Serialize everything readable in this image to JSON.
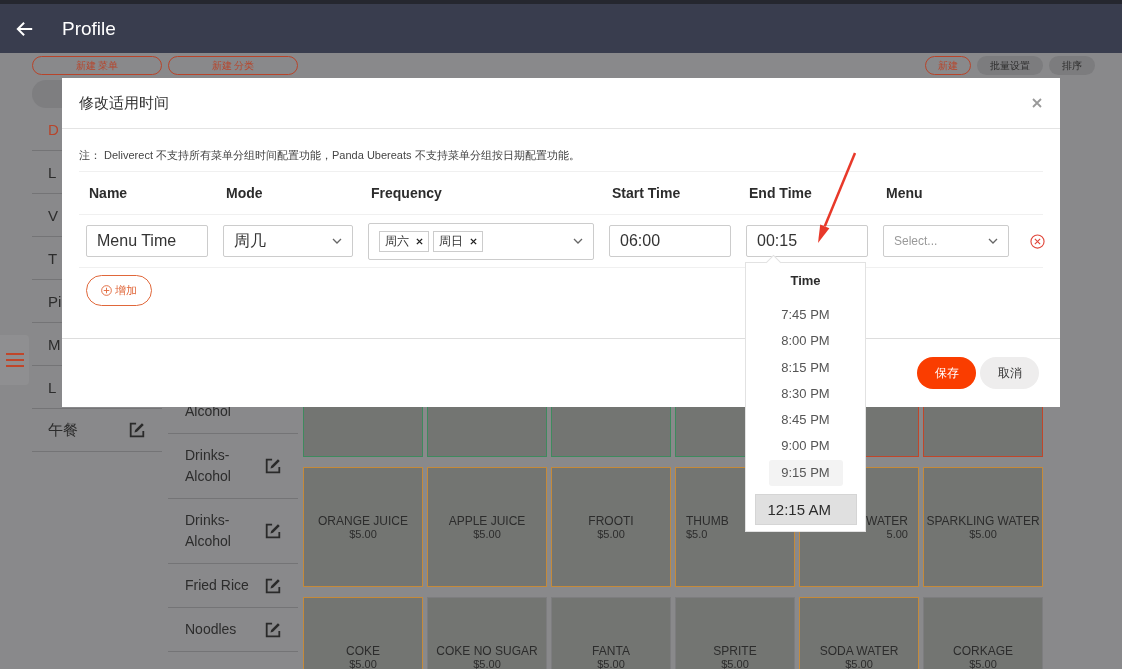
{
  "header": {
    "title": "Profile"
  },
  "toolbar": {
    "left_buttons": [
      "新建 菜单",
      "新建 分类"
    ],
    "right_buttons": [
      {
        "label": "新建",
        "kind": "outline"
      },
      {
        "label": "批量设置",
        "kind": "filled"
      },
      {
        "label": "排序",
        "kind": "filled"
      }
    ]
  },
  "sidebar": {
    "items": [
      {
        "label": "D",
        "selected": true
      },
      {
        "label": "L",
        "selected": false
      },
      {
        "label": "V",
        "selected": false
      },
      {
        "label": "T",
        "selected": false
      },
      {
        "label": "Pi",
        "selected": false
      },
      {
        "label": "M",
        "selected": false
      },
      {
        "label": "L",
        "selected": false
      },
      {
        "label": "午餐",
        "selected": false,
        "editable": true
      }
    ]
  },
  "categories": [
    {
      "label": "Alcohol",
      "editable": false
    },
    {
      "label": "Drinks-Alcohol",
      "editable": true
    },
    {
      "label": "Drinks-Alcohol",
      "editable": true
    },
    {
      "label": "Fried Rice",
      "editable": true
    },
    {
      "label": "Noodles",
      "editable": true
    }
  ],
  "products": [
    [
      {
        "color": "#3f8a5e"
      },
      {
        "color": "#3f8a5e"
      },
      {
        "color": "#3f8a5e"
      },
      {
        "color": "#3f8a5e"
      },
      {
        "color": "#c0462a"
      },
      {
        "color": "#c0462a"
      }
    ],
    [
      {
        "name": "ORANGE JUICE",
        "price": "$5.00",
        "color": "#c58a3a"
      },
      {
        "name": "APPLE JUICE",
        "price": "$5.00",
        "color": "#c58a3a"
      },
      {
        "name": "FROOTI",
        "price": "$5.00",
        "color": "#c58a3a"
      },
      {
        "name": "THUMB",
        "price": "$5.0",
        "color": "#c58a3a"
      },
      {
        "name": "WATER",
        "price": "5.00",
        "color": "#c58a3a"
      },
      {
        "name": "SPARKLING WATER",
        "price": "$5.00",
        "color": "#c58a3a"
      }
    ],
    [
      {
        "name": "COKE",
        "price": "$5.00",
        "color": "#c58a3a"
      },
      {
        "name": "COKE NO SUGAR",
        "price": "$5.00",
        "color": "#7d7d7f"
      },
      {
        "name": "FANTA",
        "price": "$5.00",
        "color": "#7d7d7f"
      },
      {
        "name": "SPRITE",
        "price": "$5.00",
        "color": "#7d7d7f"
      },
      {
        "name": "SODA WATER",
        "price": "$5.00",
        "color": "#c58a3a"
      },
      {
        "name": "CORKAGE",
        "price": "$5.00",
        "color": "#7d7d7f"
      }
    ]
  ],
  "modal": {
    "title": "修改适用时间",
    "note": "注： Deliverect 不支持所有菜单分组时间配置功能，Panda Ubereats 不支持菜单分组按日期配置功能。",
    "columns": [
      "Name",
      "Mode",
      "Frequency",
      "Start Time",
      "End Time",
      "Menu"
    ],
    "row": {
      "name": "Menu Time",
      "mode": "周几",
      "frequency": [
        "周六",
        "周日"
      ],
      "start_time": "06:00",
      "end_time": "00:15",
      "menu_placeholder": "Select..."
    },
    "add_button": "增加",
    "save_button": "保存",
    "cancel_button": "取消"
  },
  "time_picker": {
    "title": "Time",
    "options": [
      {
        "label": "7:45 PM",
        "hovered": false
      },
      {
        "label": "8:00 PM",
        "hovered": false
      },
      {
        "label": "8:15 PM",
        "hovered": false
      },
      {
        "label": "8:30 PM",
        "hovered": false
      },
      {
        "label": "8:45 PM",
        "hovered": false
      },
      {
        "label": "9:00 PM",
        "hovered": false
      },
      {
        "label": "9:15 PM",
        "hovered": true
      }
    ],
    "selected_time": "12:15 AM"
  }
}
